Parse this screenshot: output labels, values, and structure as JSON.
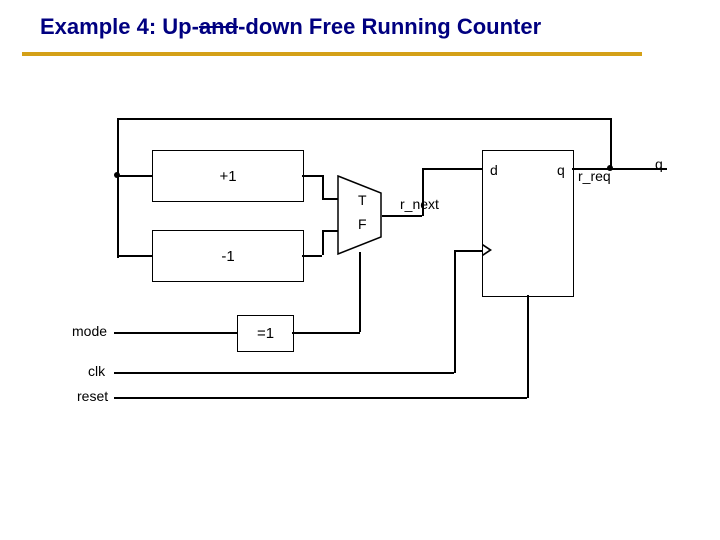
{
  "title_prefix": "Example 4: Up-",
  "title_struck": "and",
  "title_suffix": "-down Free Running Counter",
  "blocks": {
    "inc": "+1",
    "dec": "-1",
    "eq1": "=1"
  },
  "mux": {
    "top": "T",
    "bottom": "F"
  },
  "reg_ports": {
    "d": "d",
    "q": "q"
  },
  "signals": {
    "mode": "mode",
    "clk": "clk",
    "reset": "reset",
    "r_next": "r_next",
    "r_req": "r_req",
    "q": "q"
  }
}
